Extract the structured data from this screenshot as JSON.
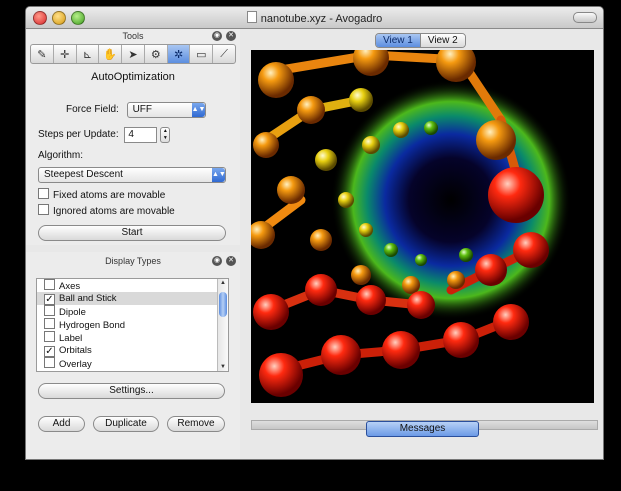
{
  "window": {
    "title": "nanotube.xyz - Avogadro"
  },
  "tools": {
    "header": "Tools",
    "section_title": "AutoOptimization",
    "force_field_label": "Force Field:",
    "force_field_value": "UFF",
    "steps_label": "Steps per Update:",
    "steps_value": "4",
    "algorithm_label": "Algorithm:",
    "algorithm_value": "Steepest Descent",
    "fixed_atoms_label": "Fixed atoms are movable",
    "ignored_atoms_label": "Ignored atoms are movable",
    "start_label": "Start",
    "toolbar_icons": [
      "pencil-icon",
      "navigate-icon",
      "measure-icon",
      "manipulate-icon",
      "select-icon",
      "bond-centric-icon",
      "autooptimize-icon",
      "align-icon",
      "ruler-icon"
    ]
  },
  "display": {
    "header": "Display Types",
    "items": [
      {
        "label": "Axes",
        "mark": ""
      },
      {
        "label": "Ball and Stick",
        "mark": "✓"
      },
      {
        "label": "Dipole",
        "mark": ""
      },
      {
        "label": "Hydrogen Bond",
        "mark": ""
      },
      {
        "label": "Label",
        "mark": ""
      },
      {
        "label": "Orbitals",
        "mark": "✓"
      },
      {
        "label": "Overlay",
        "mark": ""
      }
    ],
    "settings_label": "Settings...",
    "add_label": "Add",
    "duplicate_label": "Duplicate",
    "remove_label": "Remove"
  },
  "view": {
    "tabs": [
      "View 1",
      "View 2"
    ],
    "messages_label": "Messages"
  },
  "colors": {
    "accent": "#5c8ee0",
    "viewport_bg": "#000000"
  }
}
